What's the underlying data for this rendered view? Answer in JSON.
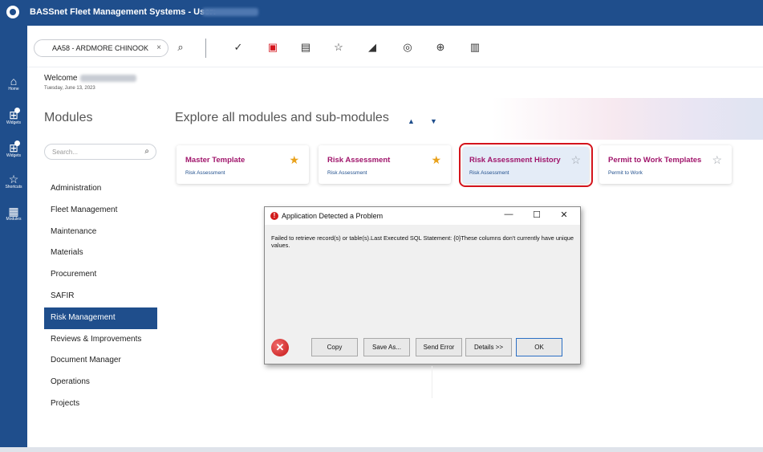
{
  "app": {
    "title": "BASSnet Fleet Management Systems - User:"
  },
  "left_rail": [
    {
      "icon": "home-icon",
      "glyph": "⌂",
      "label": "Home"
    },
    {
      "icon": "widgets-icon",
      "glyph": "⊞",
      "label": "Widgets"
    },
    {
      "icon": "widgets-icon",
      "glyph": "⊞",
      "label": "Widgets"
    },
    {
      "icon": "shortcuts-icon",
      "glyph": "☆",
      "label": "Shortcuts"
    },
    {
      "icon": "modules-icon",
      "glyph": "▦",
      "label": "Modules"
    }
  ],
  "toolbar": {
    "vessel": "AA58 - ARDMORE CHINOOK",
    "clear_glyph": "×",
    "icons": [
      {
        "name": "search-icon",
        "glyph": "⌕"
      },
      {
        "name": "checkmark-icon",
        "glyph": "✓"
      },
      {
        "name": "message-alert-icon",
        "glyph": "▣"
      },
      {
        "name": "workorder-icon",
        "glyph": "▤"
      },
      {
        "name": "favorites-list-icon",
        "glyph": "☆"
      },
      {
        "name": "chart-icon",
        "glyph": "◢"
      },
      {
        "name": "approval-icon",
        "glyph": "◎"
      },
      {
        "name": "globe-icon",
        "glyph": "⊕"
      },
      {
        "name": "report-icon",
        "glyph": "▥"
      }
    ]
  },
  "welcome": {
    "label": "Welcome",
    "date": "Tuesday, June 13, 2023"
  },
  "sidebar": {
    "title": "Modules",
    "search_placeholder": "Search...",
    "items": [
      {
        "label": "Administration",
        "active": false
      },
      {
        "label": "Fleet Management",
        "active": false
      },
      {
        "label": "Maintenance",
        "active": false
      },
      {
        "label": "Materials",
        "active": false
      },
      {
        "label": "Procurement",
        "active": false
      },
      {
        "label": "SAFIR",
        "active": false
      },
      {
        "label": "Risk Management",
        "active": true
      },
      {
        "label": "Reviews & Improvements",
        "active": false
      },
      {
        "label": "Document Manager",
        "active": false
      },
      {
        "label": "Operations",
        "active": false
      },
      {
        "label": "Projects",
        "active": false
      }
    ]
  },
  "main": {
    "explore_title": "Explore all modules and sub-modules",
    "cards": [
      {
        "title": "Master Template",
        "subtitle": "Risk Assessment",
        "favorite": true
      },
      {
        "title": "Risk Assessment",
        "subtitle": "Risk Assessment",
        "favorite": true
      },
      {
        "title": "Risk Assessment History",
        "subtitle": "Risk Assessment",
        "favorite": false,
        "highlighted": true
      },
      {
        "title": "Permit to Work Templates",
        "subtitle": "Permit to Work",
        "favorite": false
      }
    ]
  },
  "dialog": {
    "title": "Application Detected a Problem",
    "message": "Failed to retrieve record(s) or table(s).Last Executed SQL Statement: {0}These columns don't currently have unique values.",
    "buttons": [
      "Copy",
      "Save As...",
      "Send Error",
      "Details >>",
      "OK"
    ]
  },
  "colors": {
    "brand_blue": "#1f4e8c",
    "card_title": "#a0156b",
    "star_gold": "#e9a21c",
    "highlight_red": "#d4141c"
  }
}
